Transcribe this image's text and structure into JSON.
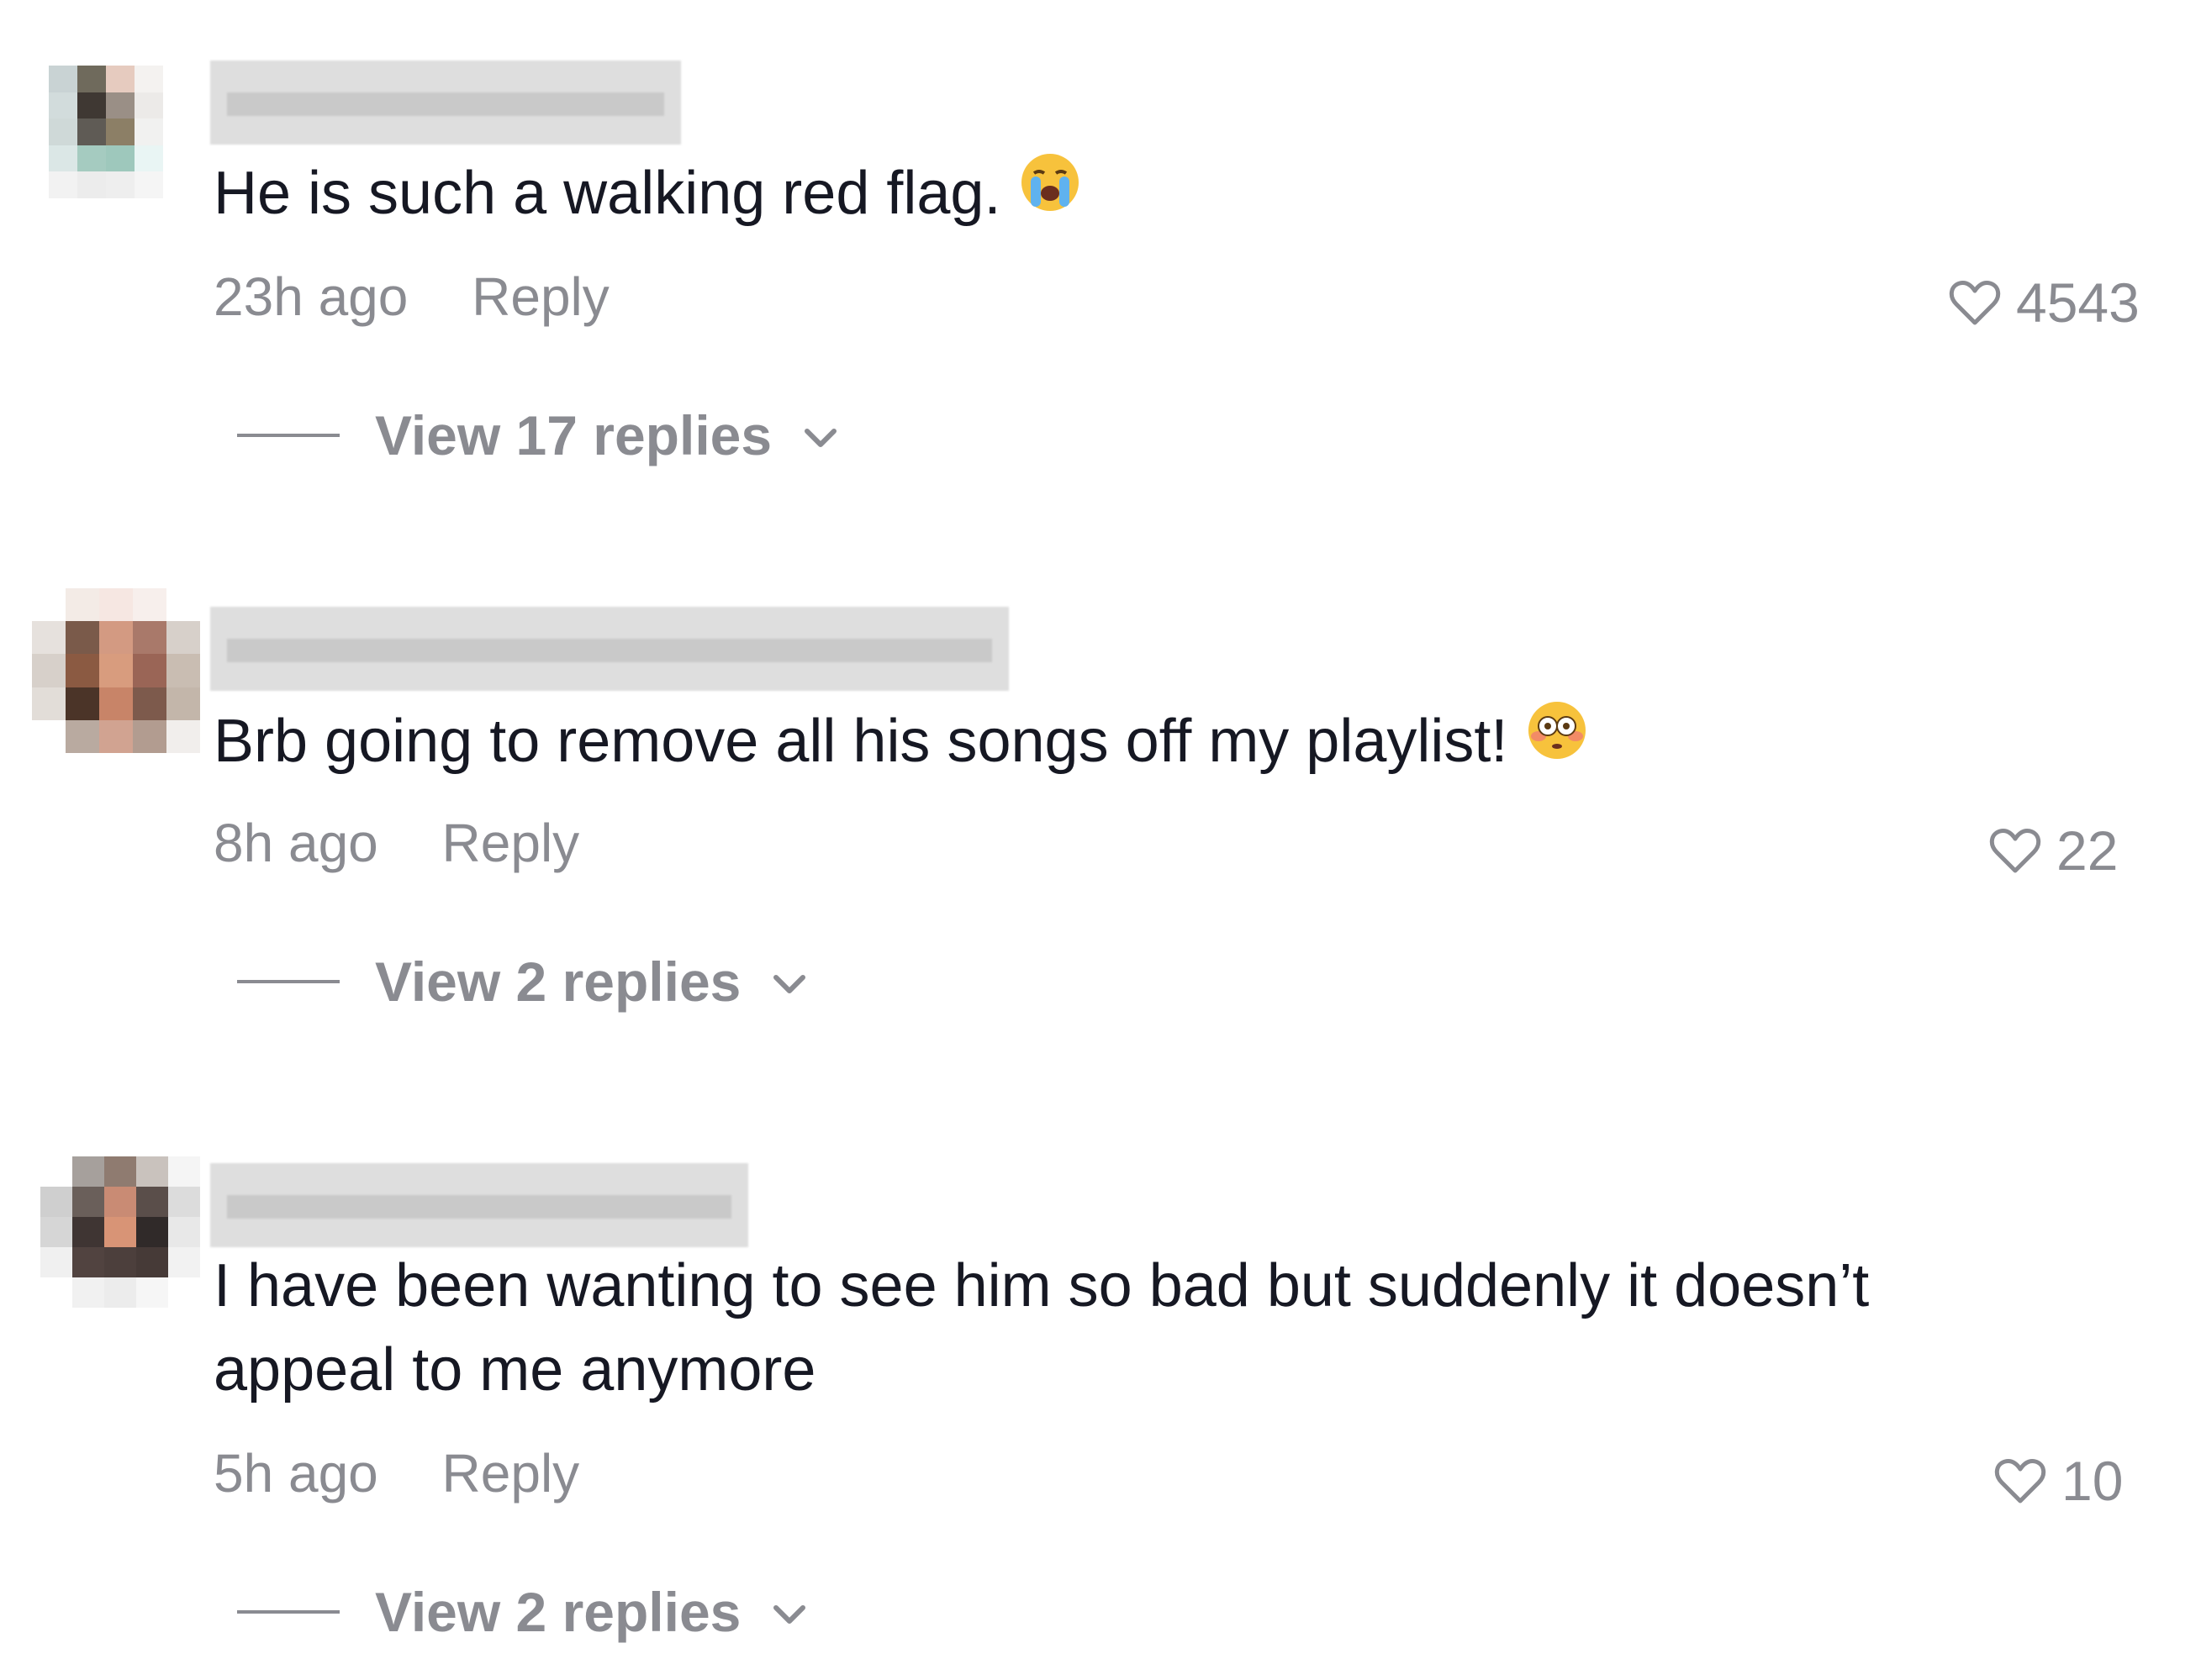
{
  "comments": [
    {
      "text": "He is such a walking red flag.",
      "emoji": "loudly-crying-face",
      "time": "23h ago",
      "reply_label": "Reply",
      "likes": "4543",
      "view_replies": "View 17 replies"
    },
    {
      "text": "Brb going to remove all his songs off my playlist!",
      "emoji": "flushed-face",
      "time": "8h ago",
      "reply_label": "Reply",
      "likes": "22",
      "view_replies": "View 2 replies"
    },
    {
      "text": "I have been wanting to see him so bad but suddenly it doesn’t appeal to me anymore",
      "time": "5h ago",
      "reply_label": "Reply",
      "likes": "10",
      "view_replies": "View 2 replies"
    }
  ],
  "colors": {
    "text": "#161823",
    "secondary": "#8a8b91",
    "background": "#ffffff"
  },
  "icons": {
    "like": "heart-outline-icon",
    "expand": "chevron-down-icon"
  }
}
